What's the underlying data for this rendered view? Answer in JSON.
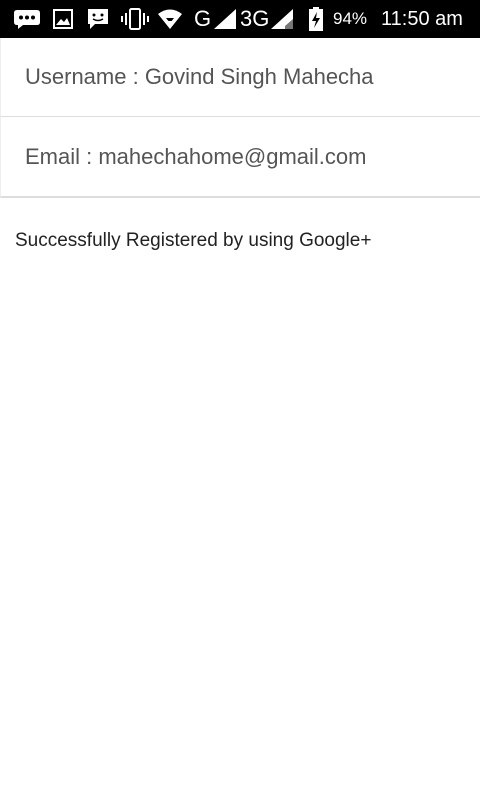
{
  "status_bar": {
    "network_type_1": "G",
    "network_type_2": "3G",
    "battery_percent": "94%",
    "time": "11:50 am",
    "icons": [
      "messenger-icon",
      "image-icon",
      "chat-icon",
      "vibrate-icon",
      "wifi-icon",
      "signal-icon",
      "signal-icon",
      "battery-charging-icon"
    ]
  },
  "profile": {
    "username_line": "Username : Govind Singh Mahecha",
    "email_line": "Email : mahechahome@gmail.com"
  },
  "message": "Successfully Registered by using Google+"
}
